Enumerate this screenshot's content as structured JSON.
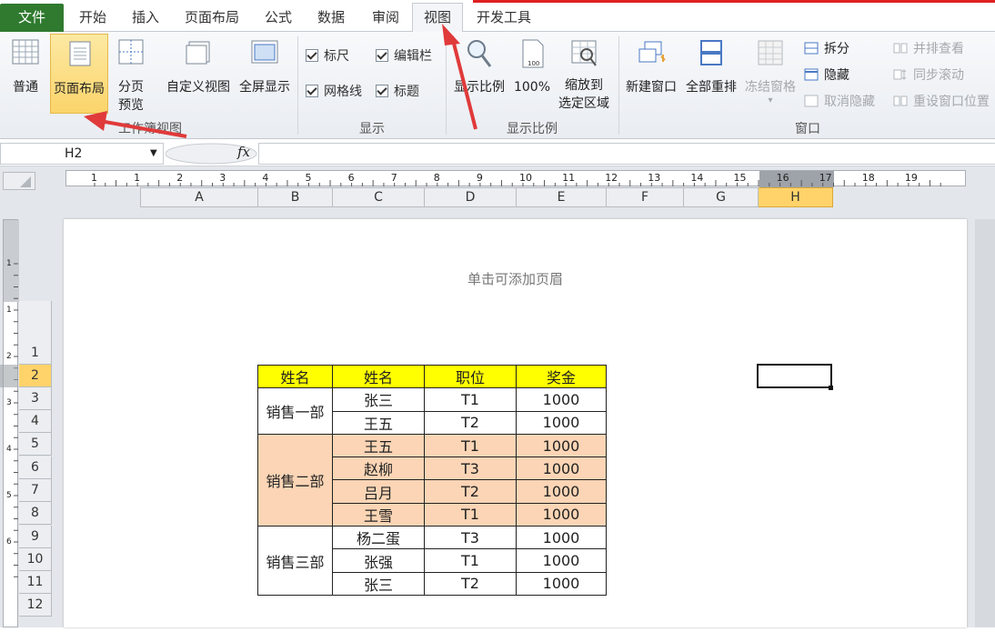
{
  "tabs": [
    "文件",
    "开始",
    "插入",
    "页面布局",
    "公式",
    "数据",
    "审阅",
    "视图",
    "开发工具"
  ],
  "active_tab": "视图",
  "ribbon": {
    "workbook_views": {
      "label": "工作簿视图",
      "buttons": [
        "普通",
        "页面布局",
        "分页\n预览",
        "自定义视图",
        "全屏显示"
      ],
      "normal": "普通",
      "page_layout": "页面布局",
      "page_break_1": "分页",
      "page_break_2": "预览",
      "custom": "自定义视图",
      "fullscreen": "全屏显示"
    },
    "show": {
      "label": "显示",
      "ruler": "标尺",
      "formula_bar": "编辑栏",
      "gridlines": "网格线",
      "headings": "标题"
    },
    "zoom": {
      "label": "显示比例",
      "zoom": "显示比例",
      "hundred": "100%",
      "zoom_sel_1": "缩放到",
      "zoom_sel_2": "选定区域"
    },
    "window": {
      "label": "窗口",
      "new_window": "新建窗口",
      "arrange_all": "全部重排",
      "freeze": "冻结窗格",
      "split": "拆分",
      "hide": "隐藏",
      "unhide": "取消隐藏",
      "side_by_side": "并排查看",
      "sync_scroll": "同步滚动",
      "reset_pos": "重设窗口位置"
    }
  },
  "namebox": "H2",
  "fx": "fx",
  "columns": [
    "A",
    "B",
    "C",
    "D",
    "E",
    "F",
    "G",
    "H"
  ],
  "selected_column": "H",
  "rows": [
    "1",
    "2",
    "3",
    "4",
    "5",
    "6",
    "7",
    "8",
    "9",
    "10",
    "11",
    "12"
  ],
  "selected_row": "2",
  "ruler_marks": [
    "1",
    "1",
    "2",
    "3",
    "4",
    "5",
    "6",
    "7",
    "8",
    "9",
    "10",
    "11",
    "12",
    "13",
    "14",
    "15",
    "16",
    "17",
    "18",
    "19"
  ],
  "vruler_marks": [
    "1",
    "1",
    "2",
    "3",
    "4",
    "5",
    "6"
  ],
  "header_hint": "单击可添加页眉",
  "table": {
    "headers": [
      "姓名",
      "姓名",
      "职位",
      "奖金"
    ],
    "groups": [
      {
        "dept": "销售一部",
        "rows": [
          [
            "张三",
            "T1",
            "1000"
          ],
          [
            "王五",
            "T2",
            "1000"
          ]
        ]
      },
      {
        "dept": "销售二部",
        "rows": [
          [
            "王五",
            "T1",
            "1000"
          ],
          [
            "赵柳",
            "T3",
            "1000"
          ],
          [
            "吕月",
            "T2",
            "1000"
          ],
          [
            "王雪",
            "T1",
            "1000"
          ]
        ]
      },
      {
        "dept": "销售三部",
        "rows": [
          [
            "杨二蛋",
            "T3",
            "1000"
          ],
          [
            "张强",
            "T1",
            "1000"
          ],
          [
            "张三",
            "T2",
            "1000"
          ]
        ]
      }
    ]
  },
  "colors": {
    "header_yellow": "#ffff00",
    "peach": "#fbd5b5",
    "file_green": "#2f7a2f",
    "arrow_red": "#e03a3a",
    "selected": "#ffd36a"
  }
}
